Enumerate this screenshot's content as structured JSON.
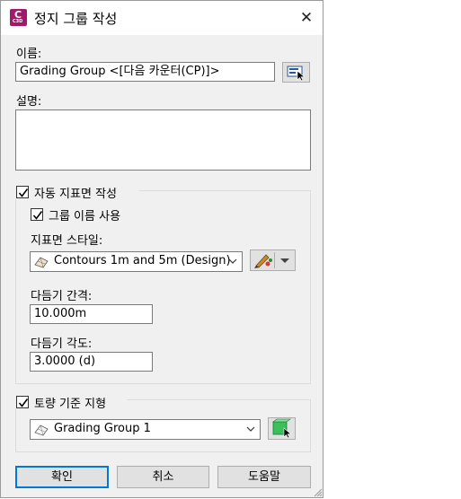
{
  "window": {
    "title": "정지 그룹 작성",
    "app_icon_letter": "C",
    "app_icon_sub": "C3D",
    "close_glyph": "✕"
  },
  "name": {
    "label": "이름:",
    "value": "Grading Group <[다음 카운터(CP)]>"
  },
  "description": {
    "label": "설명:",
    "value": ""
  },
  "auto_surface": {
    "checkbox_label": "자동 지표면 작성",
    "checked": true,
    "use_group_name_label": "그룹 이름 사용",
    "use_group_name_checked": true,
    "style_label": "지표면 스타일:",
    "style_value": "Contours 1m and 5m (Design)",
    "tessellation_spacing_label": "다듬기 간격:",
    "tessellation_spacing_value": "10.000m",
    "tessellation_angle_label": "다듬기 각도:",
    "tessellation_angle_value": "3.0000 (d)"
  },
  "volume_surface": {
    "checkbox_label": "토량 기준 지형",
    "checked": true,
    "value": "Grading Group 1"
  },
  "buttons": {
    "ok": "확인",
    "cancel": "취소",
    "help": "도움말"
  },
  "colors": {
    "app_icon": "#a01a6c",
    "default_button_border": "#0078d7",
    "dialog_bg": "#f0f0f0"
  }
}
